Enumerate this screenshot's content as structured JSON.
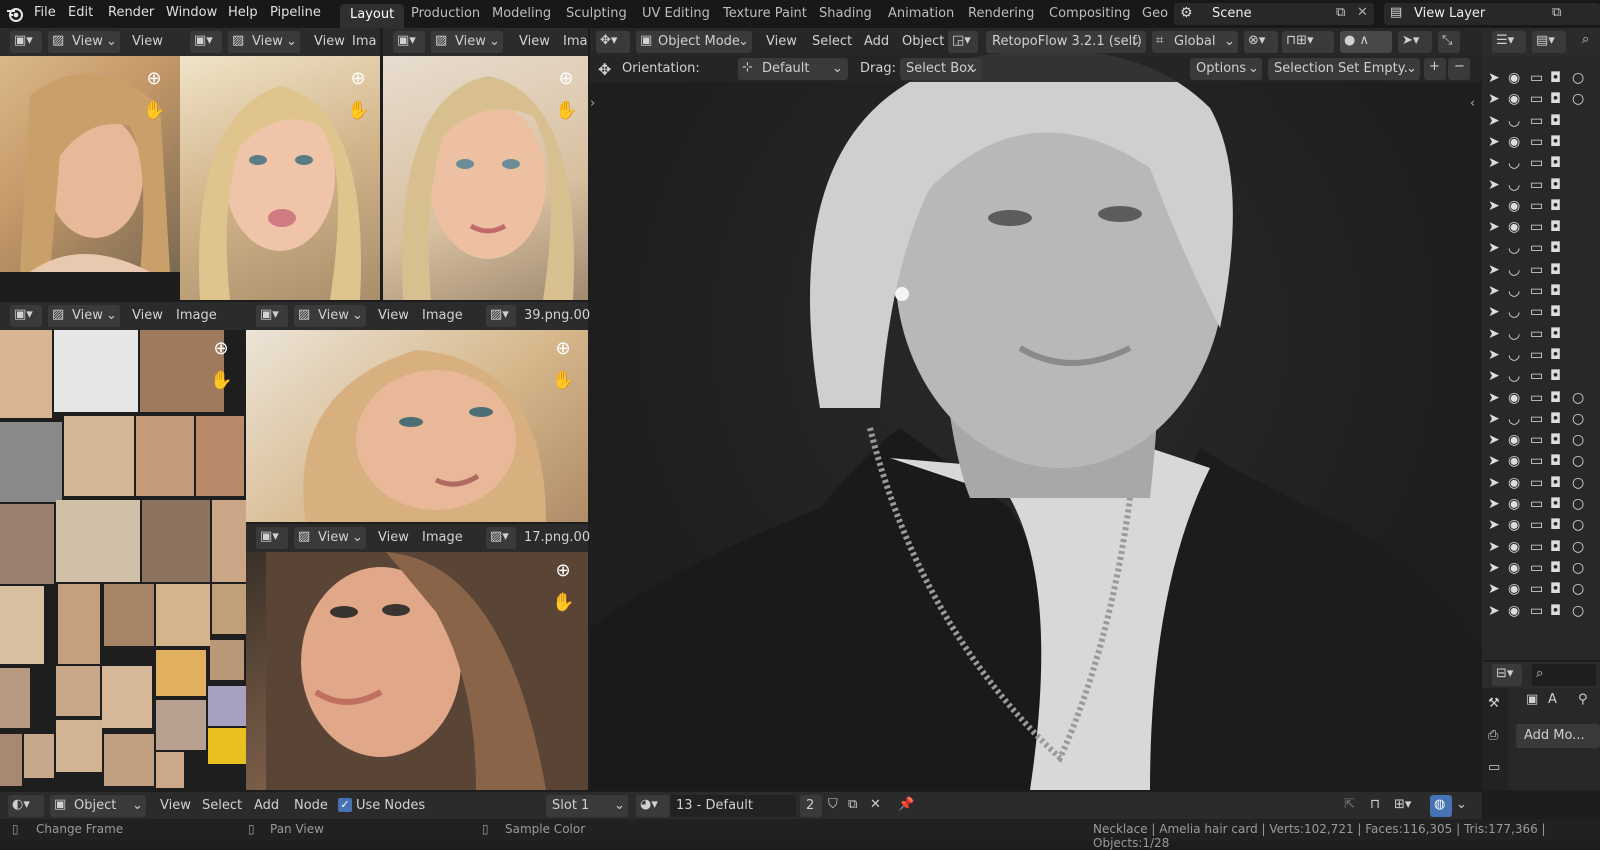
{
  "menus": [
    "File",
    "Edit",
    "Render",
    "Window",
    "Help",
    "Pipeline"
  ],
  "workspace_tabs": [
    "Layout",
    "Production",
    "Modeling",
    "Sculpting",
    "UV Editing",
    "Texture Paint",
    "Shading",
    "Animation",
    "Rendering",
    "Compositing",
    "Geo"
  ],
  "scene": "Scene",
  "view_layer": "View Layer",
  "image_editor": {
    "view": "View",
    "image": "Image",
    "ima_trunc": "Ima",
    "file_39": "39.png.00",
    "file_17": "17.png.00"
  },
  "viewport": {
    "mode": "Object Mode",
    "menu_view": "View",
    "menu_select": "Select",
    "menu_add": "Add",
    "menu_object": "Object",
    "addon": "RetopoFlow 3.2.1 (self)",
    "transform": "Global",
    "orientation_label": "Orientation:",
    "orientation": "Default",
    "drag_label": "Drag:",
    "drag": "Select Box",
    "options": "Options",
    "selection_set": "Selection Set Empty."
  },
  "outliner": {
    "rows": [
      {
        "eye": true,
        "circle": true
      },
      {
        "eye": true,
        "circle": true
      },
      {
        "eye": false,
        "circle": false
      },
      {
        "eye": true,
        "circle": false
      },
      {
        "eye": false,
        "circle": false
      },
      {
        "eye": false,
        "circle": false
      },
      {
        "eye": true,
        "circle": false
      },
      {
        "eye": true,
        "circle": false
      },
      {
        "eye": false,
        "circle": false
      },
      {
        "eye": false,
        "circle": false
      },
      {
        "eye": false,
        "circle": false
      },
      {
        "eye": false,
        "circle": false
      },
      {
        "eye": false,
        "circle": false
      },
      {
        "eye": false,
        "circle": false
      },
      {
        "eye": false,
        "circle": false
      },
      {
        "eye": true,
        "circle": true
      },
      {
        "eye": false,
        "circle": true
      },
      {
        "eye": true,
        "circle": true
      },
      {
        "eye": true,
        "circle": true
      },
      {
        "eye": true,
        "circle": true
      },
      {
        "eye": true,
        "circle": true
      },
      {
        "eye": true,
        "circle": true
      },
      {
        "eye": true,
        "circle": true
      },
      {
        "eye": true,
        "circle": true
      },
      {
        "eye": true,
        "circle": true
      },
      {
        "eye": true,
        "circle": true
      }
    ]
  },
  "properties": {
    "add_modifier": "Add Mo..."
  },
  "node_editor": {
    "type": "Object",
    "menu_view": "View",
    "menu_select": "Select",
    "menu_add": "Add",
    "menu_node": "Node",
    "use_nodes": "Use Nodes",
    "slot": "Slot 1",
    "material": "13 - Default",
    "users": "2"
  },
  "statusbar": {
    "left1": "Change Frame",
    "left2": "Pan View",
    "left3": "Sample Color",
    "stats": "Necklace | Amelia hair card | Verts:102,721 | Faces:116,305 | Tris:177,366 | Objects:1/28"
  },
  "colors": {
    "bg": "#1d1d1d",
    "header": "#2b2b2b",
    "accent": "#4772b3"
  }
}
